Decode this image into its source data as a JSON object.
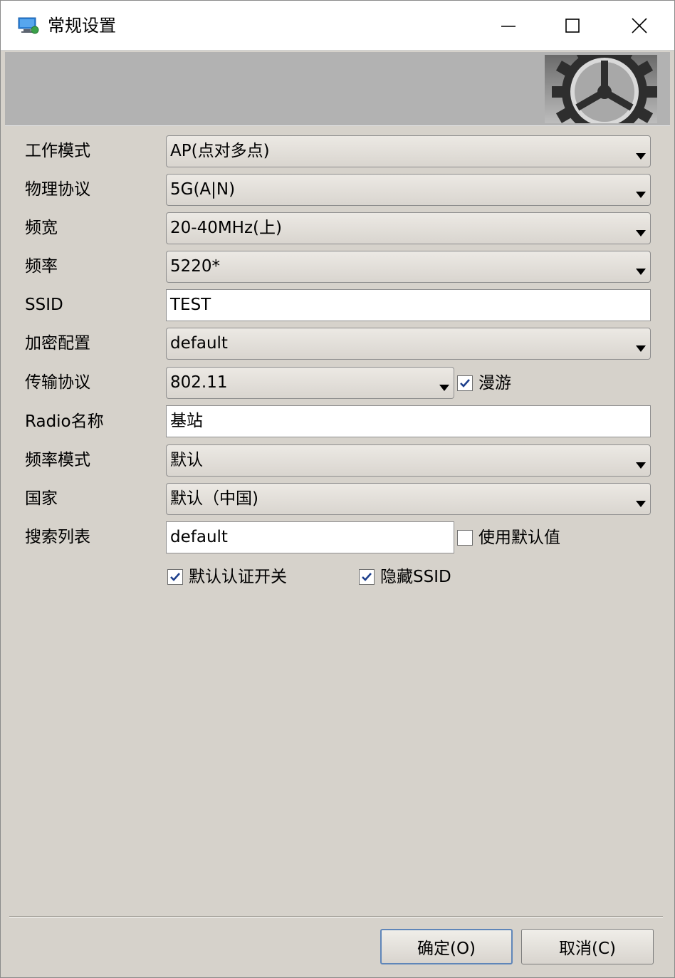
{
  "window": {
    "title": "常规设置",
    "controls": {
      "minimize": "minimize-icon",
      "maximize": "maximize-icon",
      "close": "close-icon"
    }
  },
  "banner": {
    "icon": "gear-icon"
  },
  "form": {
    "work_mode": {
      "label": "工作模式",
      "value": "AP(点对多点)"
    },
    "phy_protocol": {
      "label": "物理协议",
      "value": "5G(A|N)"
    },
    "bandwidth": {
      "label": "频宽",
      "value": "20-40MHz(上)"
    },
    "frequency": {
      "label": "频率",
      "value": "5220*"
    },
    "ssid": {
      "label": "SSID",
      "value": "TEST"
    },
    "encryption": {
      "label": "加密配置",
      "value": "default"
    },
    "transport": {
      "label": "传输协议",
      "value": "802.11",
      "roaming_label": "漫游",
      "roaming_checked": true
    },
    "radio_name": {
      "label": "Radio名称",
      "value": "基站"
    },
    "freq_mode": {
      "label": "频率模式",
      "value": "默认"
    },
    "country": {
      "label": "国家",
      "value": "默认（中国)"
    },
    "search_list": {
      "label": "搜索列表",
      "value": "default",
      "use_default_label": "使用默认值",
      "use_default_checked": false
    },
    "default_auth": {
      "label": "默认认证开关",
      "checked": true
    },
    "hide_ssid": {
      "label": "隐藏SSID",
      "checked": true
    }
  },
  "buttons": {
    "ok": "确定(O)",
    "cancel": "取消(C)"
  },
  "colors": {
    "dialog_bg": "#d6d2cb",
    "banner_bg": "#b2b2b2",
    "check_accent": "#1d3f8c"
  }
}
